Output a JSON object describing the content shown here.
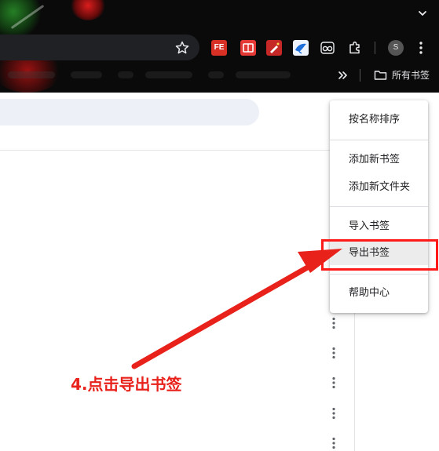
{
  "browser": {
    "extensions": {
      "fe_label": "FE"
    },
    "avatar_letter": "S",
    "bookmarks_bar": {
      "all_bookmarks_label": "所有书签"
    }
  },
  "context_menu": {
    "items": [
      {
        "label": "按名称排序"
      },
      {
        "label": "添加新书签"
      },
      {
        "label": "添加新文件夹"
      },
      {
        "label": "导入书签"
      },
      {
        "label": "导出书签"
      },
      {
        "label": "帮助中心"
      }
    ],
    "highlighted_item": "导出书签"
  },
  "annotation": {
    "text": "4.点击导出书签",
    "color": "#e8211b"
  },
  "colors": {
    "chrome_bg": "#0a0a0a",
    "page_bg": "#ffffff",
    "accent_red": "#ff1a1a"
  },
  "icons": [
    "chevron-down-icon",
    "star-icon",
    "fe-extension-icon",
    "book-extension-icon",
    "pen-extension-icon",
    "bird-extension-icon",
    "glasses-extension-icon",
    "puzzle-icon",
    "avatar",
    "more-vert-icon",
    "double-chevron-icon",
    "folder-icon"
  ]
}
